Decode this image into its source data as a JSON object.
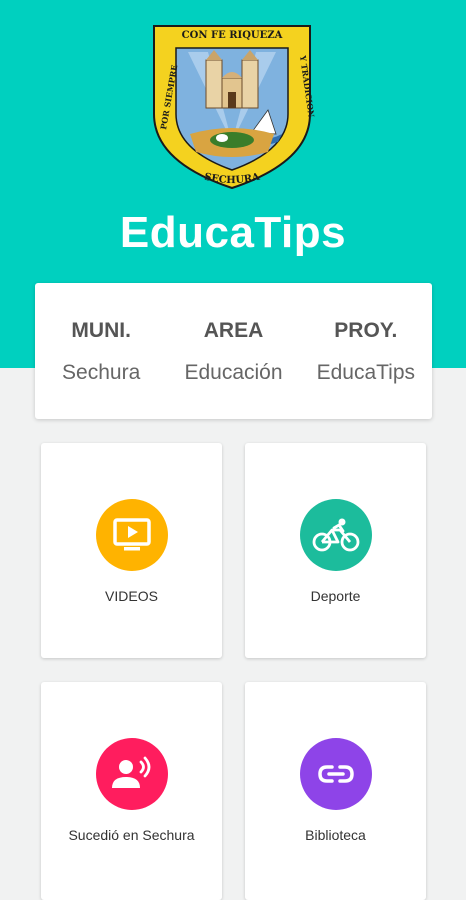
{
  "app": {
    "title": "EducaTips"
  },
  "crest": {
    "top_text": "CON FE RIQUEZA",
    "left_text": "POR SIEMPRE",
    "right_text": "Y TRADICION",
    "bottom_text": "SECHURA"
  },
  "info": [
    {
      "head": "MUNI.",
      "value": "Sechura"
    },
    {
      "head": "AREA",
      "value": "Educación"
    },
    {
      "head": "PROY.",
      "value": "EducaTips"
    }
  ],
  "tiles": [
    {
      "label": "VIDEOS",
      "icon": "tv-play-icon",
      "color": "#ffb300"
    },
    {
      "label": "Deporte",
      "icon": "bicycle-icon",
      "color": "#1cbc9c"
    },
    {
      "label": "Sucedió en Sechura",
      "icon": "speaker-person-icon",
      "color": "#ff1d5e"
    },
    {
      "label": "Biblioteca",
      "icon": "link-icon",
      "color": "#8e44e8"
    }
  ]
}
